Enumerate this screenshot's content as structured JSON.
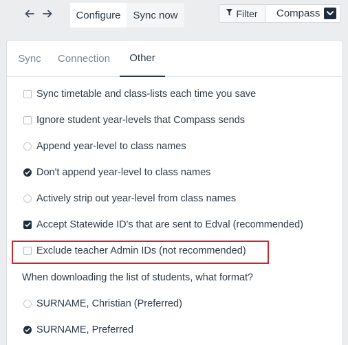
{
  "toolbar": {
    "back_icon": "arrow-left-icon",
    "forward_icon": "arrow-right-icon",
    "tabs": [
      {
        "label": "Configure",
        "active": true
      },
      {
        "label": "Sync now",
        "active": false
      }
    ],
    "filter_label": "Filter",
    "filter_icon": "funnel-icon",
    "source_select": {
      "value": "Compass",
      "icon": "chevron-down-icon"
    }
  },
  "settings": {
    "tabs": [
      {
        "label": "Sync",
        "active": false
      },
      {
        "label": "Connection",
        "active": false
      },
      {
        "label": "Other",
        "active": true
      }
    ],
    "options": [
      {
        "type": "checkbox",
        "label": "Sync timetable and class-lists each time you save",
        "checked": false
      },
      {
        "type": "checkbox",
        "label": "Ignore student year-levels that Compass sends",
        "checked": false
      },
      {
        "type": "radio",
        "label": "Append year-level to class names",
        "checked": false
      },
      {
        "type": "radio",
        "label": "Don't append year-level to class names",
        "checked": true
      },
      {
        "type": "radio",
        "label": "Actively strip out year-level from class names",
        "checked": false
      },
      {
        "type": "checkbox",
        "label": "Accept Statewide ID's that are sent to Edval (recommended)",
        "checked": true
      },
      {
        "type": "checkbox",
        "label": "Exclude teacher Admin IDs (not recommended)",
        "checked": false,
        "highlighted": true
      }
    ],
    "format_question": "When downloading the list of students, what format?",
    "format_options": [
      {
        "type": "radio",
        "label": "SURNAME, Christian (Preferred)",
        "checked": false
      },
      {
        "type": "radio",
        "label": "SURNAME, Preferred",
        "checked": true
      }
    ]
  },
  "colors": {
    "accent": "#1f2d3d",
    "highlight_border": "#d0242b",
    "background": "#ebedef"
  }
}
